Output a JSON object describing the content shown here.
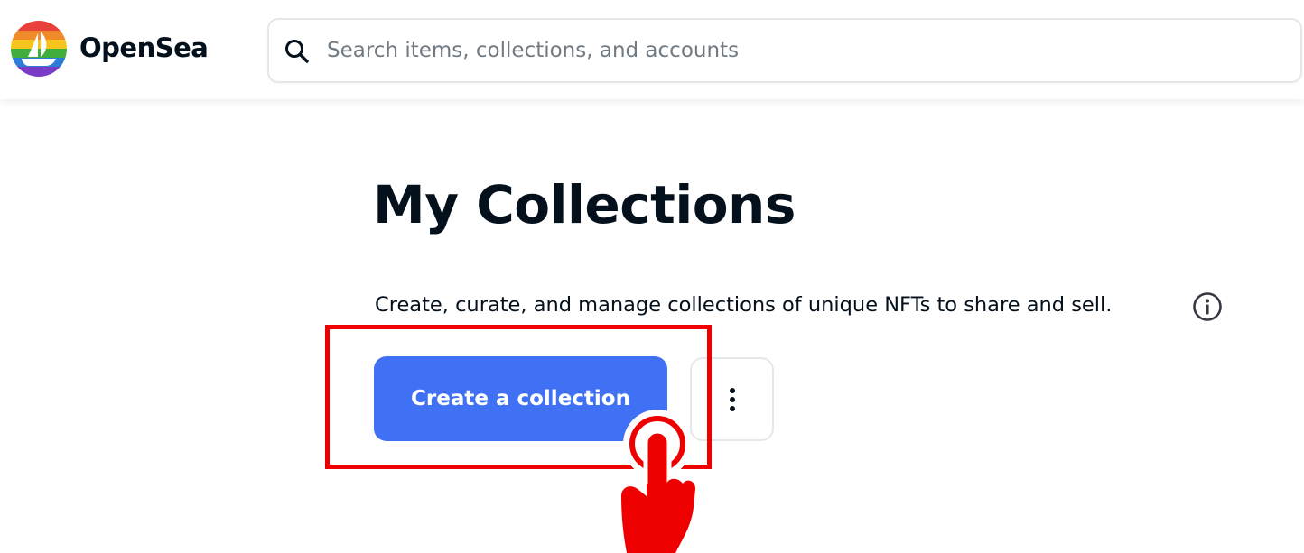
{
  "header": {
    "brand_name": "OpenSea",
    "logo_icon": "opensea-rainbow-logo",
    "search": {
      "icon": "search-icon",
      "placeholder": "Search items, collections, and accounts",
      "value": ""
    }
  },
  "main": {
    "title": "My Collections",
    "description": "Create, curate, and manage collections of unique NFTs to share and sell.",
    "info_icon": "info-icon",
    "create_button_label": "Create a collection",
    "more_button_icon": "vertical-ellipsis-icon"
  },
  "annotation": {
    "highlight_color": "#ee0000",
    "pointer_icon": "hand-pointer-icon"
  },
  "colors": {
    "primary": "#4071f4",
    "text": "#04111d",
    "placeholder": "#707a83",
    "border": "#e5e8eb"
  }
}
